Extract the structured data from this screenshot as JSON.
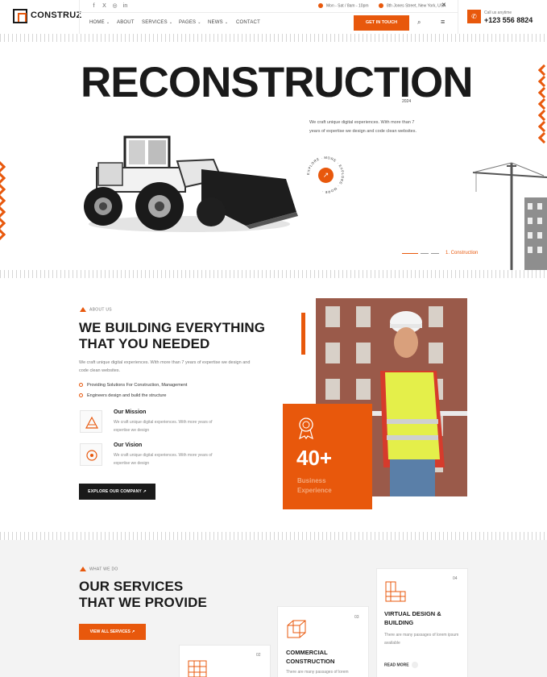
{
  "header": {
    "logo": "CONSTRUZ",
    "social": [
      "f",
      "X",
      "◎",
      "in"
    ],
    "hours": "Mon - Sat / 8am - 10pm",
    "address": "8th Jones Street, New York, USA",
    "nav": [
      {
        "label": "HOME",
        "has_dropdown": true
      },
      {
        "label": "ABOUT",
        "has_dropdown": false
      },
      {
        "label": "SERVICES",
        "has_dropdown": true
      },
      {
        "label": "PAGES",
        "has_dropdown": true
      },
      {
        "label": "NEWS",
        "has_dropdown": true
      },
      {
        "label": "CONTACT",
        "has_dropdown": false
      }
    ],
    "cta": "GET IN TOUCH",
    "call_label": "Call us anytime",
    "call_number": "+123 556 8824"
  },
  "hero": {
    "title": "RECONSTRUCTION",
    "year": "2024",
    "description": "We craft unique digital experiences. With more than 7 years of expertise we design and code clean websites.",
    "explore_ring": "EXPLORE · MORE · EXPLORE · MORE ·",
    "slide_label": "1. Construction"
  },
  "about": {
    "tag": "ABOUT US",
    "title_line1": "WE BUILDING EVERYTHING",
    "title_line2": "THAT YOU NEEDED",
    "description": "We craft unique digital experiences. With more than 7 years of expertise we design and code clean websites.",
    "checks": [
      "Providing Solutions For Construction, Management",
      "Engineers design and build the structure"
    ],
    "mission_title": "Our Mission",
    "mission_desc": "We craft unique digital experiences. With more years of expertise we design",
    "vision_title": "Our Vision",
    "vision_desc": "We craft unique digital experiences. With more years of expertise we design",
    "button": "EXPLORE OUR COMPANY",
    "experience_number": "40+",
    "experience_label_1": "Business",
    "experience_label_2": "Experience"
  },
  "services": {
    "tag": "WHAT WE DO",
    "title_line1": "OUR SERVICES",
    "title_line2": "THAT WE PROVIDE",
    "button": "VIEW ALL SERVICES",
    "cards": [
      {
        "num": "02",
        "title1": "",
        "title2": "",
        "desc": "",
        "more": ""
      },
      {
        "num": "03",
        "title1": "COMMERCIAL",
        "title2": "CONSTRUCTION",
        "desc": "There are many passages of lorem",
        "more": ""
      },
      {
        "num": "04",
        "title1": "VIRTUAL DESIGN &",
        "title2": "BUILDING",
        "desc": "There are many passages of lorem ipsum available",
        "more": "READ MORE"
      }
    ]
  },
  "colors": {
    "accent": "#e8580c",
    "dark": "#1a1a1a"
  }
}
